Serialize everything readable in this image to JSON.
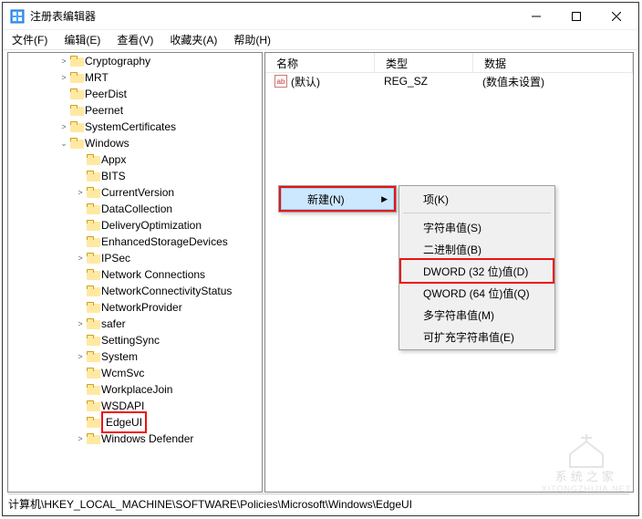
{
  "window": {
    "title": "注册表编辑器"
  },
  "menubar": {
    "file": "文件(F)",
    "edit": "编辑(E)",
    "view": "查看(V)",
    "favorites": "收藏夹(A)",
    "help": "帮助(H)"
  },
  "tree": [
    {
      "indent": 3,
      "exp": ">",
      "label": "Cryptography"
    },
    {
      "indent": 3,
      "exp": ">",
      "label": "MRT"
    },
    {
      "indent": 3,
      "exp": "",
      "label": "PeerDist"
    },
    {
      "indent": 3,
      "exp": "",
      "label": "Peernet"
    },
    {
      "indent": 3,
      "exp": ">",
      "label": "SystemCertificates"
    },
    {
      "indent": 3,
      "exp": "v",
      "label": "Windows"
    },
    {
      "indent": 4,
      "exp": "",
      "label": "Appx"
    },
    {
      "indent": 4,
      "exp": "",
      "label": "BITS"
    },
    {
      "indent": 4,
      "exp": ">",
      "label": "CurrentVersion"
    },
    {
      "indent": 4,
      "exp": "",
      "label": "DataCollection"
    },
    {
      "indent": 4,
      "exp": "",
      "label": "DeliveryOptimization"
    },
    {
      "indent": 4,
      "exp": "",
      "label": "EnhancedStorageDevices"
    },
    {
      "indent": 4,
      "exp": ">",
      "label": "IPSec"
    },
    {
      "indent": 4,
      "exp": "",
      "label": "Network Connections"
    },
    {
      "indent": 4,
      "exp": "",
      "label": "NetworkConnectivityStatus"
    },
    {
      "indent": 4,
      "exp": "",
      "label": "NetworkProvider"
    },
    {
      "indent": 4,
      "exp": ">",
      "label": "safer"
    },
    {
      "indent": 4,
      "exp": "",
      "label": "SettingSync"
    },
    {
      "indent": 4,
      "exp": ">",
      "label": "System"
    },
    {
      "indent": 4,
      "exp": "",
      "label": "WcmSvc"
    },
    {
      "indent": 4,
      "exp": "",
      "label": "WorkplaceJoin"
    },
    {
      "indent": 4,
      "exp": "",
      "label": "WSDAPI"
    },
    {
      "indent": 4,
      "exp": "",
      "label": "EdgeUI",
      "highlighted": true
    },
    {
      "indent": 4,
      "exp": ">",
      "label": "Windows Defender"
    }
  ],
  "list": {
    "headers": {
      "name": "名称",
      "type": "类型",
      "data": "数据"
    },
    "rows": [
      {
        "icon": "ab",
        "name": "(默认)",
        "type": "REG_SZ",
        "data": "(数值未设置)"
      }
    ]
  },
  "contextMenu": {
    "new": "新建(N)",
    "sub": {
      "key": "项(K)",
      "string": "字符串值(S)",
      "binary": "二进制值(B)",
      "dword": "DWORD (32 位)值(D)",
      "qword": "QWORD (64 位)值(Q)",
      "multi": "多字符串值(M)",
      "expand": "可扩充字符串值(E)"
    }
  },
  "statusbar": "计算机\\HKEY_LOCAL_MACHINE\\SOFTWARE\\Policies\\Microsoft\\Windows\\EdgeUI",
  "watermark": {
    "text": "系统之家",
    "url": "XITONGZHIJIA.NET"
  }
}
